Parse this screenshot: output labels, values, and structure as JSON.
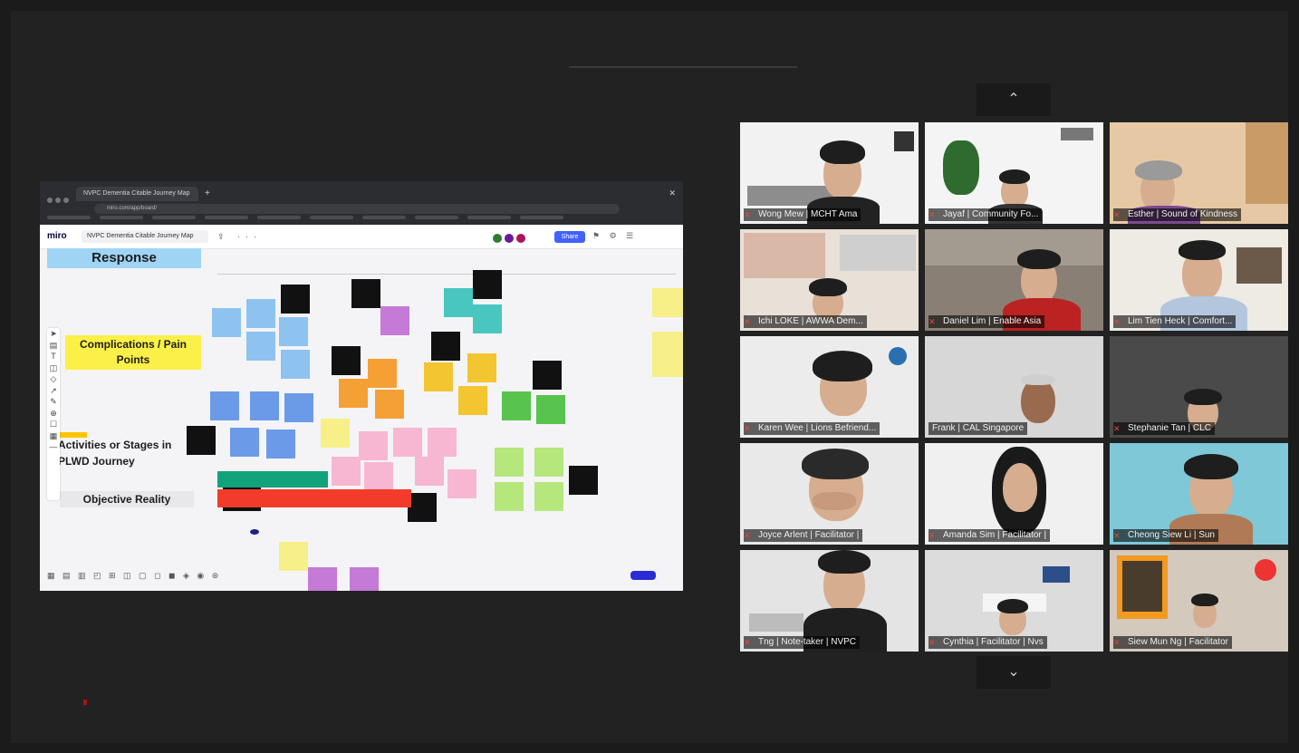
{
  "miro": {
    "logo": "miro",
    "board_title": "NVPC Dementia Citable Journey Map",
    "share_label": "Share",
    "browser_tab": "NVPC Dementia Citable Journey Map",
    "address": "miro.com/app/board/",
    "labels": {
      "response": "Response",
      "complications": "Complications / Pain Points",
      "activities": "Activities or Stages in PLWD Journey",
      "objective": "Objective Reality"
    }
  },
  "participants": [
    {
      "name": "Wong Mew | MCHT Ama"
    },
    {
      "name": "Jayaf | Community Fo..."
    },
    {
      "name": "Esther | Sound of Kindness"
    },
    {
      "name": "Ichi LOKE | AWWA Dem..."
    },
    {
      "name": "Daniel Lim | Enable Asia"
    },
    {
      "name": "Lim Tien Heck | Comfort..."
    },
    {
      "name": "Karen Wee | Lions Befriend..."
    },
    {
      "name": "Frank | CAL Singapore"
    },
    {
      "name": "Stephanie Tan | CLC"
    },
    {
      "name": "Joyce Arlent | Facilitator |"
    },
    {
      "name": "Amanda Sim | Facilitator |"
    },
    {
      "name": "Cheong Siew Li | Sun"
    },
    {
      "name": "Tng | Note-taker | NVPC"
    },
    {
      "name": "Cynthia | Facilitator | Nvs"
    },
    {
      "name": "Siew Mun Ng | Facilitator"
    }
  ],
  "nav": {
    "up": "⌃",
    "down": "⌄"
  },
  "colors": {
    "background": "#1b1b1b",
    "mic_muted": "#e5473a",
    "miro_blue": "#4262ff",
    "sticky_yellow": "#fbf047",
    "sticky_blue": "#7fb3ea",
    "sticky_orange": "#f5a035",
    "sticky_pink": "#f7b7d3",
    "sticky_green": "#7dd36d"
  }
}
